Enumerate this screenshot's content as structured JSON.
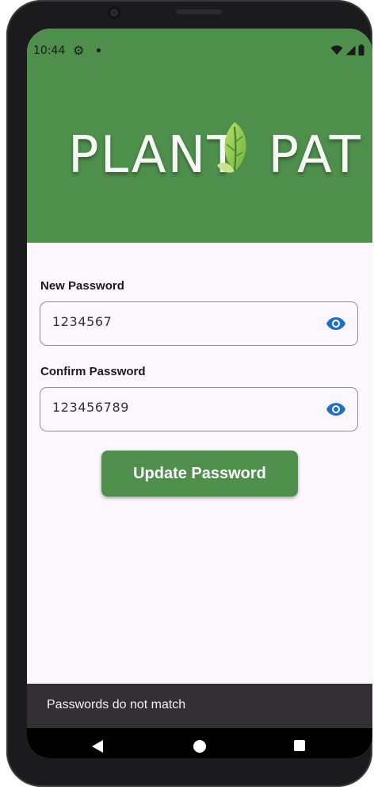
{
  "status_bar": {
    "time": "10:44",
    "icons": [
      "gear-icon",
      "notification-dot-icon",
      "wifi-icon",
      "signal-icon",
      "battery-icon"
    ]
  },
  "header": {
    "logo_text": "PLANTPAT",
    "logo_text_left": "PLANT",
    "logo_text_right": "PAT",
    "background_color": "#4e8f4c"
  },
  "form": {
    "new_password": {
      "label": "New Password",
      "value": "1234567",
      "icon": "eye-icon"
    },
    "confirm_password": {
      "label": "Confirm Password",
      "value": "123456789",
      "icon": "eye-icon"
    },
    "submit_label": "Update Password"
  },
  "snackbar": {
    "message": "Passwords do not match"
  },
  "navigation": {
    "icons": [
      "back-icon",
      "home-icon",
      "recents-icon"
    ]
  },
  "colors": {
    "brand_green": "#4e8f4c",
    "accent_blue": "#1f6fc4",
    "snackbar_bg": "#322f35",
    "screen_bg": "#fcf7fc"
  }
}
